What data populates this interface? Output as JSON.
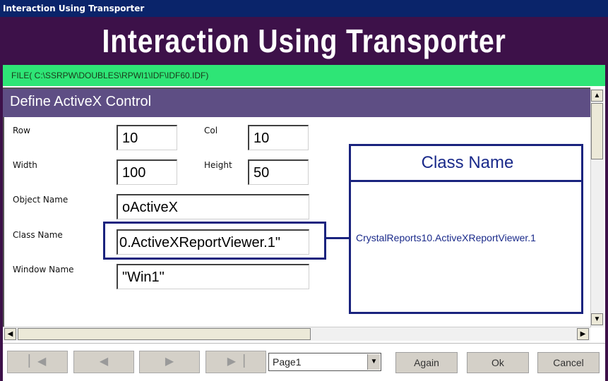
{
  "window": {
    "title": "Interaction Using Transporter"
  },
  "banner": {
    "title": "Interaction Using Transporter"
  },
  "path": {
    "text": "FILE( C:\\SSRPW\\DOUBLES\\RPWI1\\IDF\\IDF60.IDF)"
  },
  "section": {
    "title": "Define ActiveX Control"
  },
  "form": {
    "row": {
      "label": "Row",
      "value": "10"
    },
    "col": {
      "label": "Col",
      "value": "10"
    },
    "width": {
      "label": "Width",
      "value": "100"
    },
    "height": {
      "label": "Height",
      "value": "50"
    },
    "object_name": {
      "label": "Object Name",
      "value": "oActiveX"
    },
    "class_name": {
      "label": "Class Name",
      "value": "0.ActiveXReportViewer.1\""
    },
    "window_name": {
      "label": "Window Name",
      "value": "\"Win1\""
    }
  },
  "callout": {
    "title": "Class Name",
    "value": "CrystalReports10.ActiveXReportViewer.1"
  },
  "footer": {
    "page_select": "Page1",
    "again": "Again",
    "ok": "Ok",
    "cancel": "Cancel"
  },
  "colors": {
    "banner_bg": "#3d1149",
    "path_bg": "#2ee576",
    "section_bg": "#5e4e84",
    "callout_border": "#1a237e",
    "titlebar_bg": "#0a246a"
  },
  "icons": {
    "first": "first-page-icon",
    "prev": "prev-page-icon",
    "next": "next-page-icon",
    "last": "last-page-icon"
  }
}
